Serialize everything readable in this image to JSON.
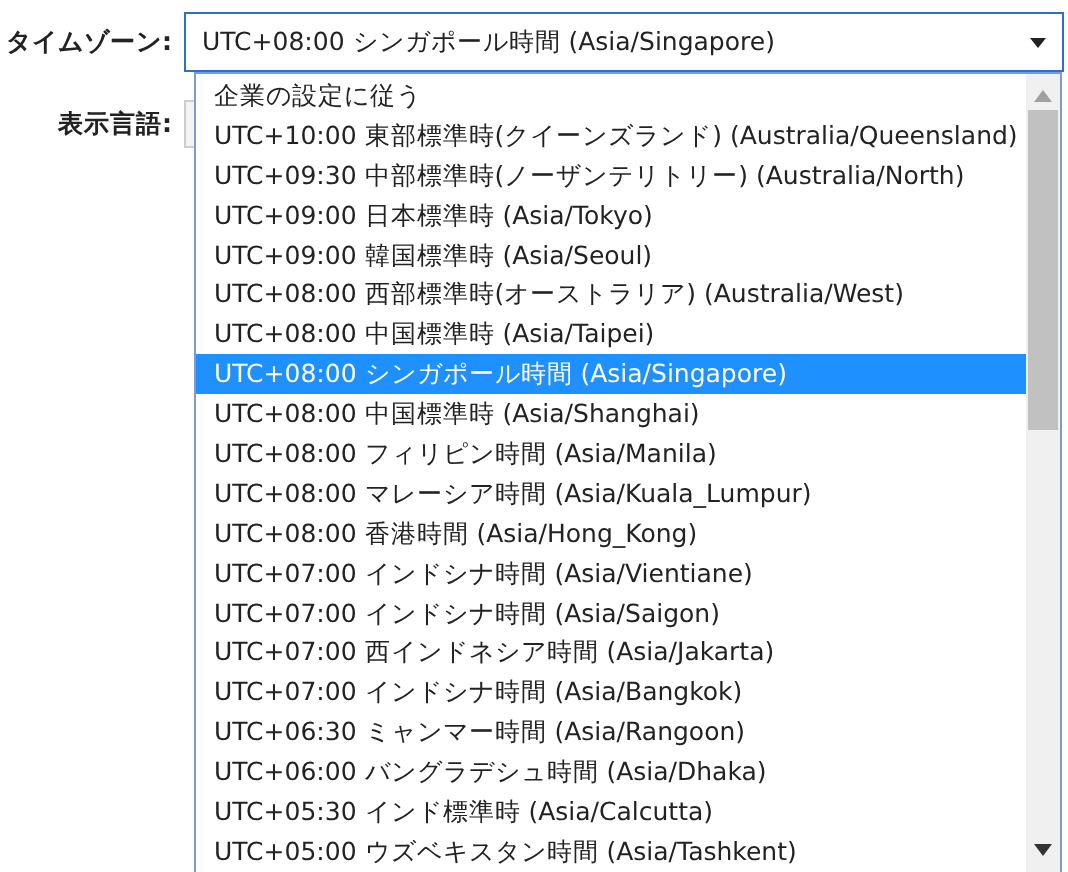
{
  "timezone": {
    "label": "タイムゾーン:",
    "value": "UTC+08:00 シンガポール時間 (Asia/Singapore)",
    "options": [
      {
        "label": "企業の設定に従う",
        "selected": false
      },
      {
        "label": "UTC+10:00 東部標準時(クイーンズランド) (Australia/Queensland)",
        "selected": false
      },
      {
        "label": "UTC+09:30 中部標準時(ノーザンテリトリー) (Australia/North)",
        "selected": false
      },
      {
        "label": "UTC+09:00 日本標準時 (Asia/Tokyo)",
        "selected": false
      },
      {
        "label": "UTC+09:00 韓国標準時 (Asia/Seoul)",
        "selected": false
      },
      {
        "label": "UTC+08:00 西部標準時(オーストラリア) (Australia/West)",
        "selected": false
      },
      {
        "label": "UTC+08:00 中国標準時 (Asia/Taipei)",
        "selected": false
      },
      {
        "label": "UTC+08:00 シンガポール時間 (Asia/Singapore)",
        "selected": true
      },
      {
        "label": "UTC+08:00 中国標準時 (Asia/Shanghai)",
        "selected": false
      },
      {
        "label": "UTC+08:00 フィリピン時間 (Asia/Manila)",
        "selected": false
      },
      {
        "label": "UTC+08:00 マレーシア時間 (Asia/Kuala_Lumpur)",
        "selected": false
      },
      {
        "label": "UTC+08:00 香港時間 (Asia/Hong_Kong)",
        "selected": false
      },
      {
        "label": "UTC+07:00 インドシナ時間 (Asia/Vientiane)",
        "selected": false
      },
      {
        "label": "UTC+07:00 インドシナ時間 (Asia/Saigon)",
        "selected": false
      },
      {
        "label": "UTC+07:00 西インドネシア時間 (Asia/Jakarta)",
        "selected": false
      },
      {
        "label": "UTC+07:00 インドシナ時間 (Asia/Bangkok)",
        "selected": false
      },
      {
        "label": "UTC+06:30 ミャンマー時間 (Asia/Rangoon)",
        "selected": false
      },
      {
        "label": "UTC+06:00 バングラデシュ時間 (Asia/Dhaka)",
        "selected": false
      },
      {
        "label": "UTC+05:30 インド標準時 (Asia/Calcutta)",
        "selected": false
      },
      {
        "label": "UTC+05:00 ウズベキスタン時間 (Asia/Tashkent)",
        "selected": false
      }
    ]
  },
  "display_language": {
    "label": "表示言語:"
  }
}
